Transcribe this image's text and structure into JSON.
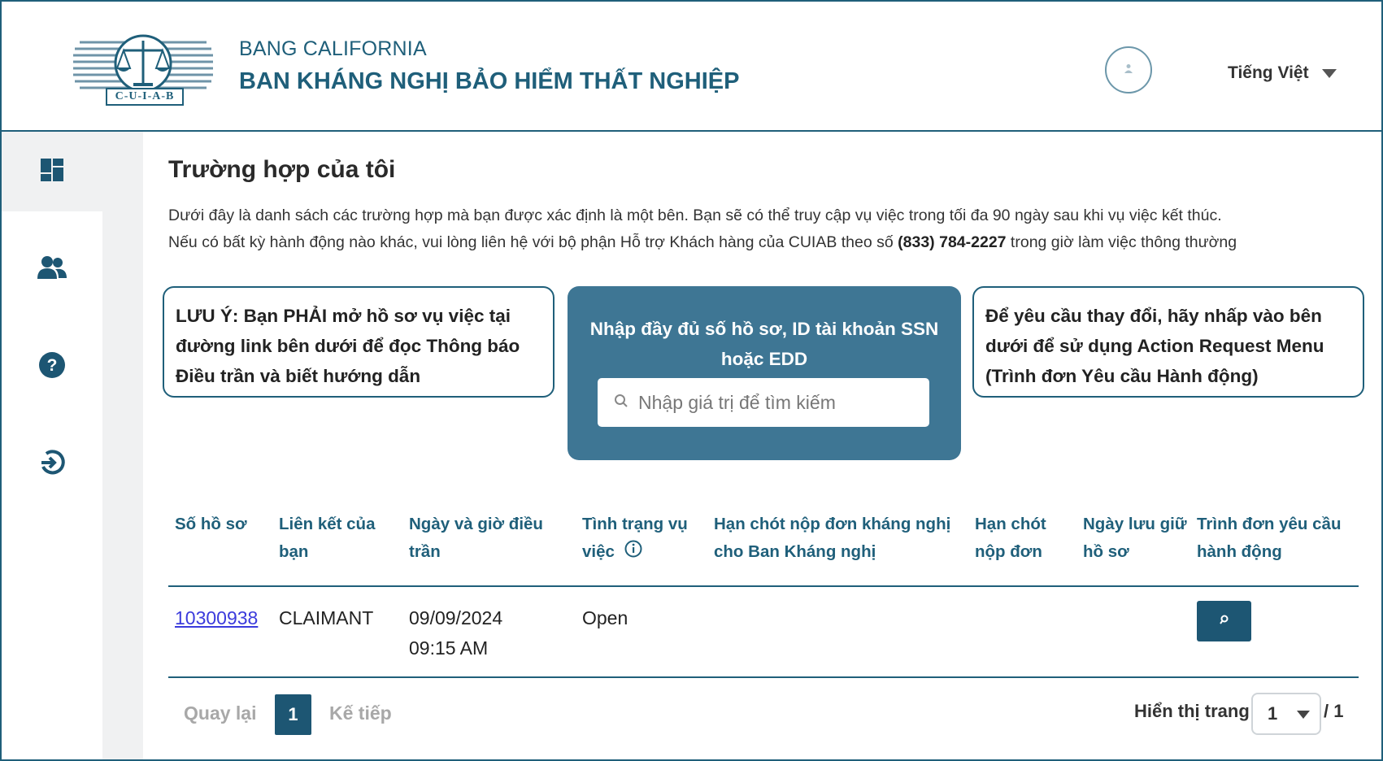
{
  "header": {
    "logo_text": "C-U-I-A-B",
    "state": "BANG CALIFORNIA",
    "agency": "BAN KHÁNG NGHỊ BẢO HIỂM THẤT NGHIỆP",
    "language": "Tiếng Việt"
  },
  "sidebar": {
    "items": [
      {
        "icon": "dashboard-icon",
        "active": true
      },
      {
        "icon": "users-icon"
      },
      {
        "icon": "help-icon"
      },
      {
        "icon": "logout-icon"
      }
    ]
  },
  "main": {
    "title": "Trường hợp của tôi",
    "desc_line1": "Dưới đây là danh sách các trường hợp mà bạn được xác định là một bên. Bạn sẽ có thể truy cập vụ việc trong tối đa 90 ngày sau khi vụ việc kết thúc.",
    "desc_line2_pre": "Nếu có bất kỳ hành động nào khác, vui lòng liên hệ với bộ phận Hỗ trợ Khách hàng của CUIAB theo số ",
    "desc_phone": "(833) 784-2227",
    "desc_line2_post": " trong giờ làm việc thông thường"
  },
  "notes": {
    "left": "LƯU Ý: Bạn PHẢI mở hồ sơ vụ việc tại đường link bên dưới để đọc Thông báo Điều trần và biết hướng dẫn",
    "right": "Để yêu cầu thay đổi, hãy nhấp vào bên dưới để sử dụng Action Request Menu (Trình đơn Yêu cầu Hành động)"
  },
  "search": {
    "label": "Nhập đầy đủ số hồ sơ, ID tài khoản SSN hoặc EDD",
    "placeholder": "Nhập giá trị để tìm kiếm"
  },
  "table": {
    "headers": [
      "Số hồ sơ",
      "Liên kết của bạn",
      "Ngày và giờ điều trần",
      "Tình trạng vụ việc",
      "Hạn chót nộp đơn kháng nghị cho Ban Kháng nghị",
      "Hạn chót nộp đơn",
      "Ngày lưu giữ hồ sơ",
      "Trình đơn yêu cầu hành động"
    ],
    "rows": [
      {
        "case_number": "10300938",
        "affiliation": "CLAIMANT",
        "hearing_date": "09/09/2024",
        "hearing_time": "09:15 AM",
        "status": "Open",
        "appeal_deadline": "",
        "filing_deadline": "",
        "retention_date": ""
      }
    ]
  },
  "pagination": {
    "prev": "Quay lại",
    "current_page": "1",
    "next": "Kế tiếp",
    "showing_label": "Hiển thị trang",
    "selected_page": "1",
    "total": "/ 1"
  },
  "colors": {
    "brand": "#1f5f7a",
    "search_panel": "#3e7694",
    "button": "#1d5673",
    "link": "#3b3bdc"
  }
}
